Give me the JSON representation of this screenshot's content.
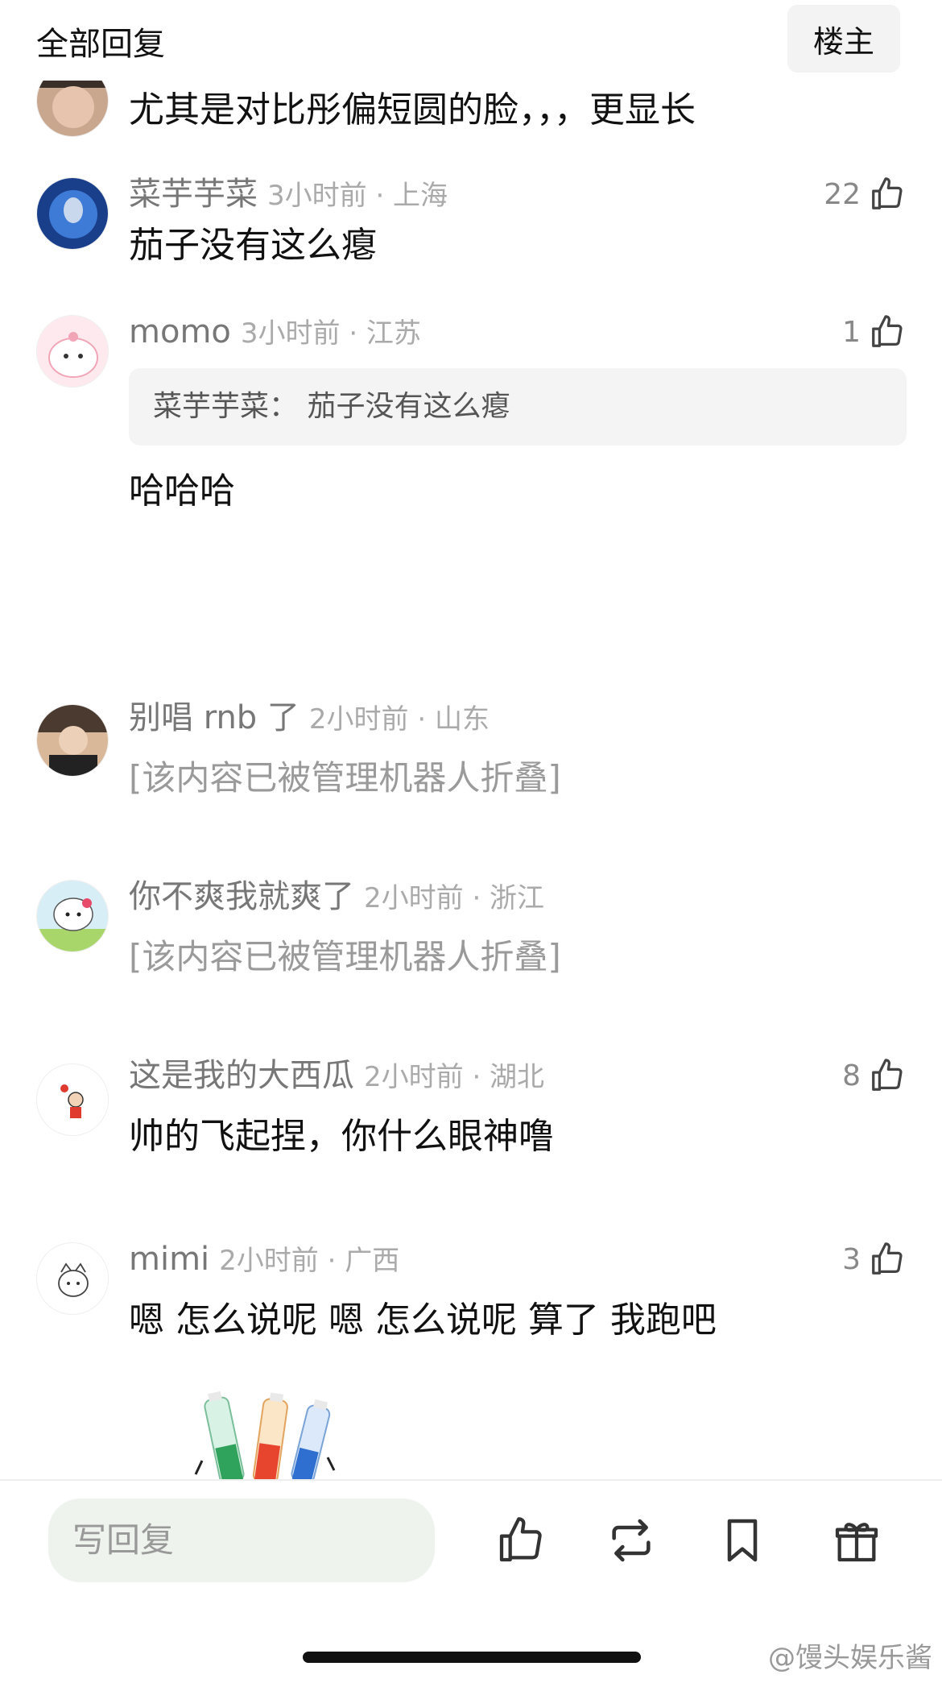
{
  "header": {
    "title": "全部回复",
    "owner_button": "楼主"
  },
  "comments": [
    {
      "text": "尤其是对比彤偏短圆的脸，，，更显长"
    },
    {
      "user": "菜芋芋菜",
      "meta": "3小时前 · 上海",
      "likes": "22",
      "text": "茄子没有这么瘪"
    },
    {
      "user": "momo",
      "meta": "3小时前 · 江苏",
      "likes": "1",
      "quote": "菜芋芋菜：  茄子没有这么瘪",
      "text": "哈哈哈"
    },
    {
      "user": "别唱 rnb 了",
      "meta": "2小时前 · 山东",
      "folded": "[该内容已被管理机器人折叠]"
    },
    {
      "user": "你不爽我就爽了",
      "meta": "2小时前 · 浙江",
      "folded": "[该内容已被管理机器人折叠]"
    },
    {
      "user": "这是我的大西瓜",
      "meta": "2小时前 · 湖北",
      "likes": "8",
      "text": "帅的飞起捏，你什么眼神噜"
    },
    {
      "user": "mimi",
      "meta": "2小时前 · 广西",
      "likes": "3",
      "text": "嗯 怎么说呢 嗯 怎么说呢 算了 我跑吧"
    }
  ],
  "bottom_bar": {
    "reply_placeholder": "写回复",
    "icons": [
      "like-icon",
      "repost-icon",
      "bookmark-icon",
      "gift-icon"
    ]
  },
  "watermark": "@馒头娱乐酱"
}
